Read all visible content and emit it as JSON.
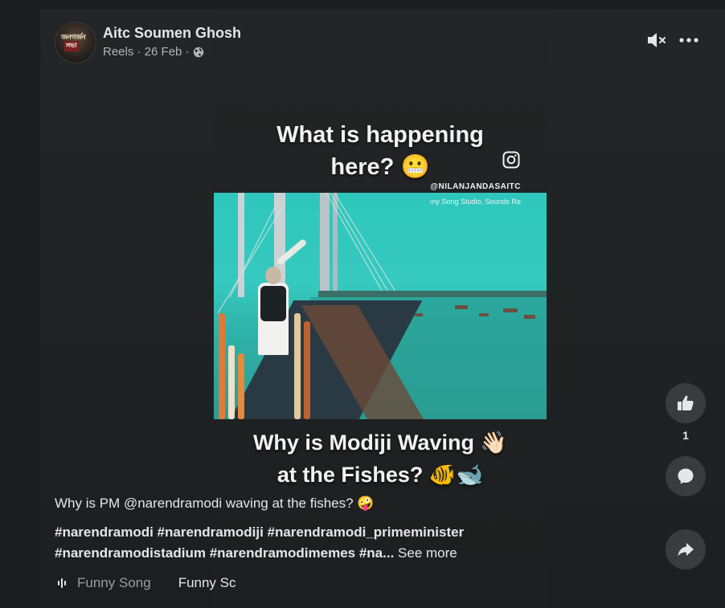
{
  "post": {
    "author": "Aitc Soumen Ghosh",
    "avatar_text_1": "জনগর্জন",
    "avatar_text_2": "সভা",
    "meta": "Reels · 26 Feb ·",
    "privacy_icon": "globe-icon"
  },
  "video": {
    "top_text_1": "What is happening",
    "top_text_2": "here? 😬",
    "handle": "@NILANJANDASAITC",
    "music_credit": "ıny Song Studio, Sounds Re",
    "bottom_text_1": "Why is Modiji Waving 👋🏻",
    "bottom_text_2": "at the Fishes? 🐠🐋"
  },
  "actions": {
    "like_count": "1"
  },
  "caption": {
    "text": "Why is PM @narendramodi waving at the fishes? 🤪",
    "tags_line_1": "#narendramodi #narendramodiji #narendramodi_primeminister",
    "tags_line_2": "#narendramodistadium #narendramodimemes #na...",
    "see_more": "See more"
  },
  "audio": {
    "track_1": "Funny Song",
    "track_2": "Funny Sc"
  },
  "colors": {
    "background": "#1b1d1f",
    "button": "#3a3b3c",
    "text_primary": "#e4e6eb",
    "text_secondary": "#b0b3b8",
    "video_teal": "#36c9bf"
  }
}
